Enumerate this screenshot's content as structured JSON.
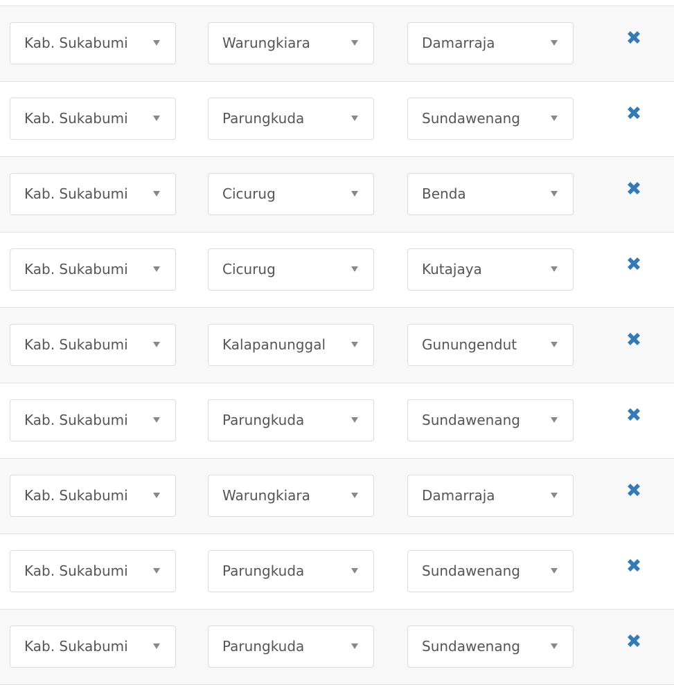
{
  "rows": [
    {
      "kabupaten": "Kab. Sukabumi",
      "kecamatan": "Warungkiara",
      "desa": "Damarraja"
    },
    {
      "kabupaten": "Kab. Sukabumi",
      "kecamatan": "Parungkuda",
      "desa": "Sundawenang"
    },
    {
      "kabupaten": "Kab. Sukabumi",
      "kecamatan": "Cicurug",
      "desa": "Benda"
    },
    {
      "kabupaten": "Kab. Sukabumi",
      "kecamatan": "Cicurug",
      "desa": "Kutajaya"
    },
    {
      "kabupaten": "Kab. Sukabumi",
      "kecamatan": "Kalapanunggal",
      "desa": "Gunungendut"
    },
    {
      "kabupaten": "Kab. Sukabumi",
      "kecamatan": "Parungkuda",
      "desa": "Sundawenang"
    },
    {
      "kabupaten": "Kab. Sukabumi",
      "kecamatan": "Warungkiara",
      "desa": "Damarraja"
    },
    {
      "kabupaten": "Kab. Sukabumi",
      "kecamatan": "Parungkuda",
      "desa": "Sundawenang"
    },
    {
      "kabupaten": "Kab. Sukabumi",
      "kecamatan": "Parungkuda",
      "desa": "Sundawenang"
    }
  ],
  "icons": {
    "dropdown": "caret-down-icon",
    "remove": "close-icon"
  },
  "colors": {
    "remove_icon": "#337ab7",
    "row_stripe": "#f8f8f8",
    "text": "#555555"
  }
}
